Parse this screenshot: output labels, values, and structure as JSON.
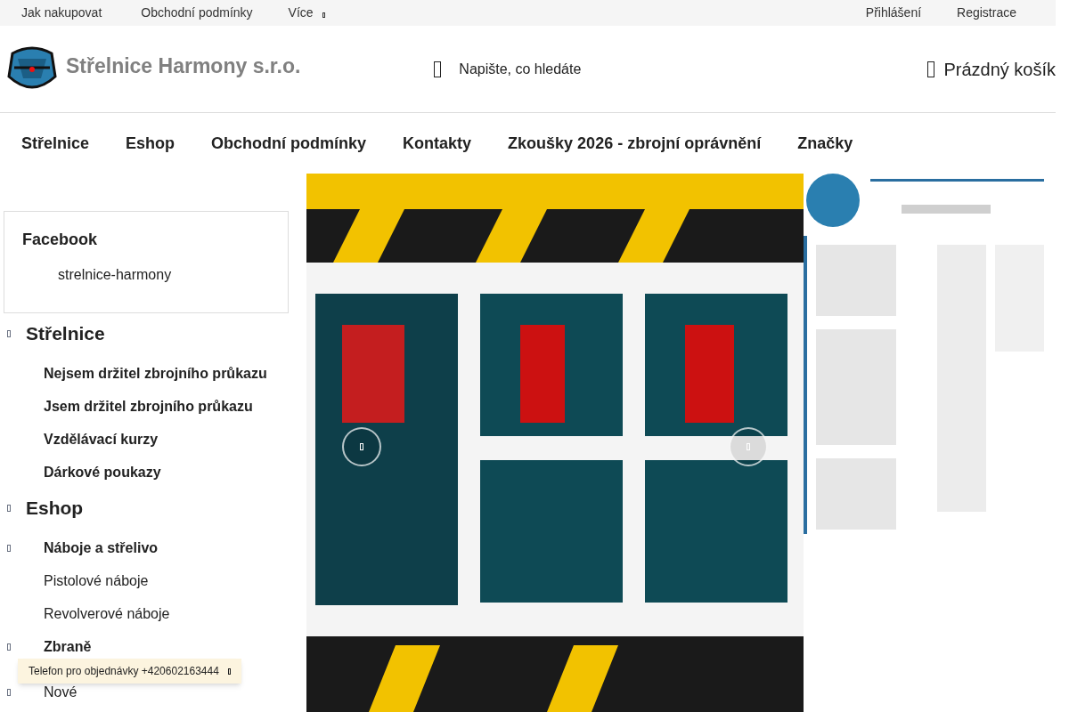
{
  "topbar": {
    "left": [
      {
        "label": "Jak nakupovat"
      },
      {
        "label": "Obchodní podmínky"
      }
    ],
    "more": "Více",
    "right": [
      {
        "label": "Přihlášení"
      },
      {
        "label": "Registrace"
      }
    ]
  },
  "header": {
    "logo_text": "Střelnice Harmony s.r.o.",
    "search": {
      "placeholder": "Napište, co hledáte"
    },
    "cart": "Prázdný košík"
  },
  "nav": [
    {
      "label": "Střelnice"
    },
    {
      "label": "Eshop"
    },
    {
      "label": "Obchodní podmínky"
    },
    {
      "label": "Kontakty"
    },
    {
      "label": "Zkoušky 2026 - zbrojní oprávnění"
    },
    {
      "label": "Značky"
    }
  ],
  "sidebar": {
    "facebook": {
      "title": "Facebook",
      "link": "strelnice-harmony"
    },
    "categories": [
      {
        "label": "Střelnice",
        "expandable": true,
        "children": [
          {
            "label": "Nejsem držitel zbrojního průkazu",
            "expandable": false
          },
          {
            "label": "Jsem držitel zbrojního průkazu",
            "expandable": false
          },
          {
            "label": "Vzdělávací kurzy",
            "expandable": false
          },
          {
            "label": "Dárkové poukazy",
            "expandable": false
          }
        ]
      },
      {
        "label": "Eshop",
        "expandable": true,
        "children": [
          {
            "label": "Náboje a střelivo",
            "expandable": true,
            "children": [
              {
                "label": "Pistolové náboje",
                "expandable": false
              },
              {
                "label": "Revolverové náboje",
                "expandable": false
              }
            ]
          },
          {
            "label": "Zbraně",
            "expandable": true,
            "children": [
              {
                "label": "Nové",
                "expandable": true
              }
            ]
          }
        ]
      }
    ]
  },
  "toast": {
    "text": "Telefon pro objednávky +420602163444"
  }
}
